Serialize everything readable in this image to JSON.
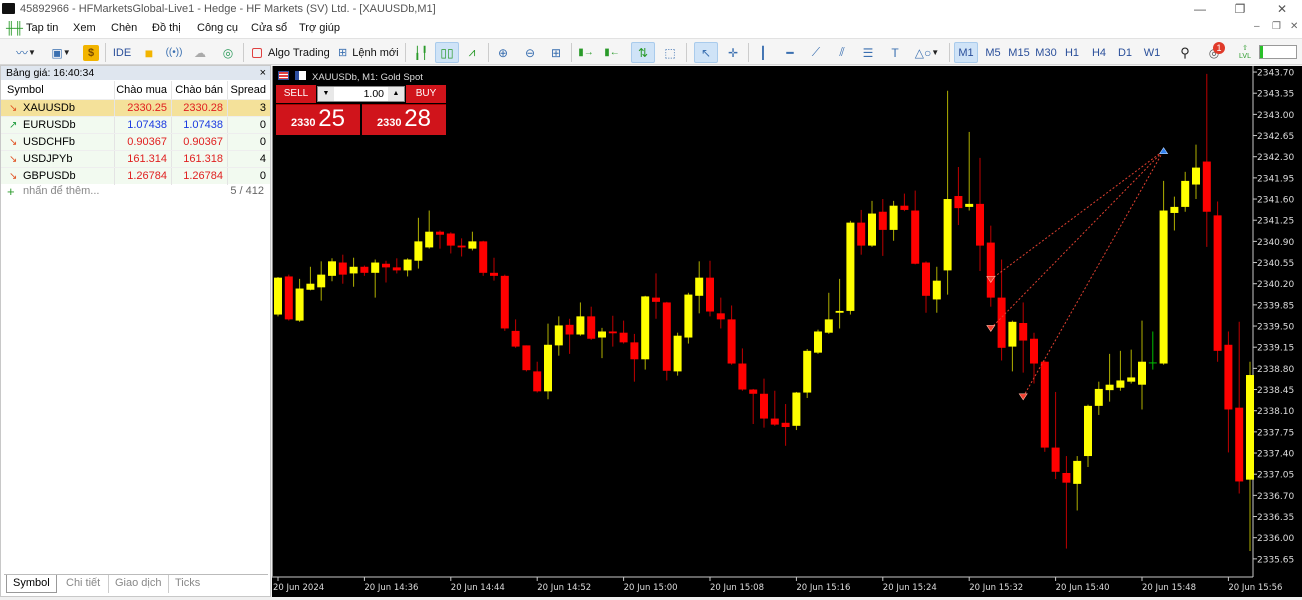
{
  "window": {
    "title": "45892966 - HFMarketsGlobal-Live1 - Hedge - HF Markets (SV) Ltd. - [XAUUSDb,M1]",
    "minimize": "—",
    "restore": "❐",
    "close": "✕"
  },
  "menu": [
    "Tap tin",
    "Xem",
    "Chèn",
    "Đồ thị",
    "Công cụ",
    "Cửa sổ",
    "Trợ giúp"
  ],
  "toolbar": {
    "ide": "IDE",
    "algo_trading": "Algo Trading",
    "new_order": "Lệnh mới",
    "timeframes": [
      "M1",
      "M5",
      "M15",
      "M30",
      "H1",
      "H4",
      "D1",
      "W1"
    ],
    "active_timeframe": "M1",
    "notifications_count": "1",
    "level_label": "LVL"
  },
  "market_watch": {
    "title": "Bảng giá: 16:40:34",
    "close": "×",
    "columns": [
      "Symbol",
      "Chào mua",
      "Chào bán",
      "Spread"
    ],
    "rows": [
      {
        "symbol": "XAUUSDb",
        "bid": "2330.25",
        "ask": "2330.28",
        "spread": "3",
        "dir": "down",
        "selected": true
      },
      {
        "symbol": "EURUSDb",
        "bid": "1.07438",
        "ask": "1.07438",
        "spread": "0",
        "dir": "up"
      },
      {
        "symbol": "USDCHFb",
        "bid": "0.90367",
        "ask": "0.90367",
        "spread": "0",
        "dir": "down"
      },
      {
        "symbol": "USDJPYb",
        "bid": "161.314",
        "ask": "161.318",
        "spread": "4",
        "dir": "down"
      },
      {
        "symbol": "GBPUSDb",
        "bid": "1.26784",
        "ask": "1.26784",
        "spread": "0",
        "dir": "down"
      }
    ],
    "add_placeholder": "nhấn để thêm...",
    "count": "5 / 412",
    "tabs": [
      "Symbol",
      "Chi tiết",
      "Giao dịch",
      "Ticks"
    ],
    "active_tab": "Symbol"
  },
  "chart": {
    "label": "XAUUSDb, M1:  Gold Spot",
    "trade_panel": {
      "sell": "SELL",
      "buy": "BUY",
      "volume": "1.00",
      "sell_big": "2330",
      "sell_small": "25",
      "buy_big": "2330",
      "buy_small": "28"
    },
    "colors": {
      "bull": "#ffff00",
      "bear": "#ff0000",
      "doji": "#00c000",
      "axis": "#c8c8c8"
    }
  },
  "chart_data": {
    "type": "candlestick",
    "symbol": "XAUUSDb",
    "timeframe": "M1",
    "ylim": [
      2335.35,
      2343.8
    ],
    "yticks": [
      "2343.70",
      "2343.35",
      "2343.00",
      "2342.65",
      "2342.30",
      "2341.95",
      "2341.60",
      "2341.25",
      "2340.90",
      "2340.55",
      "2340.20",
      "2339.85",
      "2339.50",
      "2339.15",
      "2338.80",
      "2338.45",
      "2338.10",
      "2337.75",
      "2337.40",
      "2337.05",
      "2336.70",
      "2336.35",
      "2336.00",
      "2335.65"
    ],
    "xticks": [
      "20 Jun 2024",
      "20 Jun 14:36",
      "20 Jun 14:44",
      "20 Jun 14:52",
      "20 Jun 15:00",
      "20 Jun 15:08",
      "20 Jun 15:16",
      "20 Jun 15:24",
      "20 Jun 15:32",
      "20 Jun 15:40",
      "20 Jun 15:48",
      "20 Jun 15:56"
    ],
    "xtick_minutes": 8,
    "ohlc": [
      [
        2339.69,
        2340.31,
        2339.66,
        2340.3
      ],
      [
        2340.32,
        2340.35,
        2339.59,
        2339.61
      ],
      [
        2339.59,
        2340.28,
        2339.57,
        2340.12
      ],
      [
        2340.1,
        2340.48,
        2340.09,
        2340.2
      ],
      [
        2340.14,
        2340.57,
        2339.92,
        2340.35
      ],
      [
        2340.33,
        2340.62,
        2340.24,
        2340.57
      ],
      [
        2340.55,
        2340.68,
        2340.2,
        2340.35
      ],
      [
        2340.37,
        2340.63,
        2340.15,
        2340.48
      ],
      [
        2340.48,
        2340.5,
        2340.33,
        2340.38
      ],
      [
        2340.38,
        2340.6,
        2339.97,
        2340.55
      ],
      [
        2340.53,
        2340.58,
        2340.22,
        2340.47
      ],
      [
        2340.47,
        2340.62,
        2340.37,
        2340.42
      ],
      [
        2340.42,
        2340.62,
        2340.32,
        2340.6
      ],
      [
        2340.58,
        2341.29,
        2340.45,
        2340.9
      ],
      [
        2340.8,
        2341.41,
        2340.78,
        2341.06
      ],
      [
        2341.06,
        2341.08,
        2340.78,
        2341.01
      ],
      [
        2341.03,
        2341.05,
        2340.7,
        2340.83
      ],
      [
        2340.83,
        2340.95,
        2340.65,
        2340.8
      ],
      [
        2340.78,
        2341.06,
        2340.75,
        2340.9
      ],
      [
        2340.9,
        2340.91,
        2340.33,
        2340.38
      ],
      [
        2340.38,
        2340.63,
        2340.25,
        2340.33
      ],
      [
        2340.33,
        2340.35,
        2339.42,
        2339.46
      ],
      [
        2339.42,
        2339.61,
        2339.14,
        2339.16
      ],
      [
        2339.18,
        2339.18,
        2338.75,
        2338.77
      ],
      [
        2338.75,
        2338.91,
        2338.4,
        2338.42
      ],
      [
        2338.42,
        2339.54,
        2338.29,
        2339.19
      ],
      [
        2339.18,
        2339.66,
        2339.01,
        2339.51
      ],
      [
        2339.52,
        2339.62,
        2339.04,
        2339.36
      ],
      [
        2339.36,
        2339.89,
        2339.34,
        2339.66
      ],
      [
        2339.66,
        2339.82,
        2339.27,
        2339.29
      ],
      [
        2339.31,
        2339.47,
        2338.97,
        2339.41
      ],
      [
        2339.41,
        2339.67,
        2339.16,
        2339.38
      ],
      [
        2339.39,
        2339.59,
        2339.21,
        2339.23
      ],
      [
        2339.23,
        2339.37,
        2338.58,
        2338.95
      ],
      [
        2338.95,
        2340.0,
        2338.78,
        2339.99
      ],
      [
        2339.97,
        2340.37,
        2339.62,
        2339.9
      ],
      [
        2339.89,
        2339.9,
        2338.6,
        2338.76
      ],
      [
        2338.75,
        2339.39,
        2338.68,
        2339.34
      ],
      [
        2339.31,
        2340.05,
        2339.21,
        2340.02
      ],
      [
        2340.0,
        2340.57,
        2339.71,
        2340.3
      ],
      [
        2340.3,
        2340.58,
        2339.66,
        2339.74
      ],
      [
        2339.71,
        2339.97,
        2339.46,
        2339.61
      ],
      [
        2339.61,
        2339.84,
        2338.86,
        2338.88
      ],
      [
        2338.88,
        2339.13,
        2338.43,
        2338.45
      ],
      [
        2338.45,
        2338.46,
        2337.88,
        2338.38
      ],
      [
        2338.38,
        2338.63,
        2337.82,
        2337.97
      ],
      [
        2337.97,
        2338.43,
        2337.85,
        2337.87
      ],
      [
        2337.9,
        2338.21,
        2337.52,
        2337.83
      ],
      [
        2337.85,
        2338.41,
        2337.78,
        2338.4
      ],
      [
        2338.4,
        2339.12,
        2338.31,
        2339.09
      ],
      [
        2339.06,
        2339.44,
        2339.04,
        2339.41
      ],
      [
        2339.39,
        2340.05,
        2339.37,
        2339.61
      ],
      [
        2339.72,
        2340.28,
        2339.46,
        2339.75
      ],
      [
        2339.75,
        2341.24,
        2339.69,
        2341.21
      ],
      [
        2341.21,
        2341.42,
        2340.68,
        2340.83
      ],
      [
        2340.83,
        2341.57,
        2340.81,
        2341.36
      ],
      [
        2341.39,
        2341.6,
        2340.66,
        2341.09
      ],
      [
        2341.09,
        2341.57,
        2340.91,
        2341.49
      ],
      [
        2341.49,
        2341.69,
        2341.4,
        2341.42
      ],
      [
        2341.41,
        2341.74,
        2340.52,
        2340.53
      ],
      [
        2340.55,
        2340.57,
        2339.72,
        2340.0
      ],
      [
        2339.94,
        2340.48,
        2339.72,
        2340.25
      ],
      [
        2340.42,
        2343.39,
        2340.02,
        2341.6
      ],
      [
        2341.65,
        2342.13,
        2341.17,
        2341.45
      ],
      [
        2341.47,
        2342.71,
        2341.41,
        2341.52
      ],
      [
        2341.52,
        2342.28,
        2340.41,
        2340.83
      ],
      [
        2340.88,
        2341.16,
        2339.82,
        2339.97
      ],
      [
        2339.97,
        2340.6,
        2338.93,
        2339.14
      ],
      [
        2339.16,
        2339.59,
        2338.75,
        2339.57
      ],
      [
        2339.55,
        2339.89,
        2338.73,
        2339.26
      ],
      [
        2339.29,
        2339.39,
        2338.55,
        2338.88
      ],
      [
        2338.91,
        2338.93,
        2337.42,
        2337.49
      ],
      [
        2337.49,
        2338.41,
        2336.97,
        2337.09
      ],
      [
        2337.07,
        2337.35,
        2335.82,
        2336.91
      ],
      [
        2336.89,
        2337.35,
        2336.45,
        2337.27
      ],
      [
        2337.35,
        2338.2,
        2337.17,
        2338.18
      ],
      [
        2338.18,
        2338.58,
        2338.03,
        2338.46
      ],
      [
        2338.44,
        2339.04,
        2338.25,
        2338.53
      ],
      [
        2338.48,
        2339.09,
        2338.43,
        2338.6
      ],
      [
        2338.58,
        2339.11,
        2338.55,
        2338.65
      ],
      [
        2338.53,
        2339.59,
        2338.12,
        2338.91
      ],
      [
        2338.89,
        2339.41,
        2338.78,
        2338.89
      ],
      [
        2338.88,
        2341.9,
        2338.86,
        2341.41
      ],
      [
        2341.37,
        2341.64,
        2341.08,
        2341.47
      ],
      [
        2341.47,
        2342.05,
        2341.39,
        2341.9
      ],
      [
        2341.84,
        2342.5,
        2341.6,
        2342.12
      ],
      [
        2342.22,
        2343.67,
        2340.81,
        2341.39
      ],
      [
        2341.33,
        2341.56,
        2338.91,
        2339.09
      ],
      [
        2339.19,
        2339.41,
        2337.41,
        2338.12
      ],
      [
        2338.15,
        2339.57,
        2336.73,
        2336.93
      ],
      [
        2336.96,
        2338.91,
        2335.78,
        2338.69
      ]
    ],
    "trades": [
      {
        "type": "sell",
        "bar": 66,
        "price": 2340.27,
        "close_bar": 82,
        "close_price": 2342.4
      },
      {
        "type": "sell",
        "bar": 66,
        "price": 2339.46,
        "close_bar": 82,
        "close_price": 2342.4
      },
      {
        "type": "sell",
        "bar": 69,
        "price": 2338.33,
        "close_bar": 82,
        "close_price": 2342.4
      }
    ]
  }
}
